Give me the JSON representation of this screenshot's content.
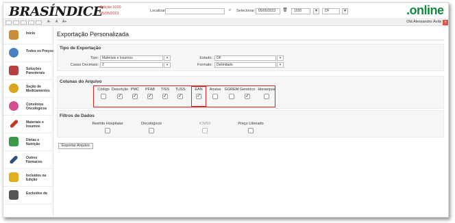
{
  "header": {
    "logo": "BRASÍNDICE",
    "edition": "Edição 1020",
    "date": "05/05/2023",
    "search_label": "Localizar:",
    "search_value": "",
    "search_btn": "⌕",
    "select_label": "Selecionar:",
    "select_date": "05/05/2023",
    "edition_num": "1020",
    "state": "DF",
    "brand": ".online"
  },
  "toolbar": {
    "font_small": "A-",
    "font_normal": "A",
    "font_large": "A+",
    "user": "Olá Alessandro Ávila",
    "close": "×"
  },
  "sidebar": {
    "items": [
      {
        "label": "Início",
        "icon": "home-icon",
        "color": "#c98d3b"
      },
      {
        "label": "Todos os Preços",
        "icon": "magnifier-icon",
        "color": "#4a7fc1"
      },
      {
        "label": "Soluções Parenterais",
        "icon": "iv-bag-icon",
        "color": "#b94040"
      },
      {
        "label": "Seção de Medicamentos",
        "icon": "pill-icon",
        "color": "#d9a420"
      },
      {
        "label": "Convênios Oncológicos",
        "icon": "ribbon-icon",
        "color": "#d14f8f"
      },
      {
        "label": "Materiais e Insumos",
        "icon": "pencil-icon",
        "color": "#c0392b"
      },
      {
        "label": "Dietas e Nutrição",
        "icon": "bottle-icon",
        "color": "#3a9a4a"
      },
      {
        "label": "Outros Fármacos",
        "icon": "syringe-icon",
        "color": "#2d4f7c"
      },
      {
        "label": "Incluídos na Edição",
        "icon": "box-plus-icon",
        "color": "#e0b020"
      },
      {
        "label": "Excluídos da",
        "icon": "box-minus-icon",
        "color": "#555"
      }
    ]
  },
  "main": {
    "title": "Exportação Personalizada",
    "tipo": {
      "title": "Tipo de Exportação",
      "tipo_label": "Tipo:",
      "tipo_value": "Materiais e Insumos",
      "casas_label": "Casas Decimais:",
      "casas_value": "2",
      "estado_label": "Estado:",
      "estado_value": "DF",
      "formato_label": "Formato:",
      "formato_value": "Delimitado"
    },
    "colunas": {
      "title": "Colunas do Arquivo",
      "items": [
        {
          "label": "Código",
          "checked": false
        },
        {
          "label": "Descrição",
          "checked": true
        },
        {
          "label": "PMC",
          "checked": true
        },
        {
          "label": "PFAB",
          "checked": true
        },
        {
          "label": "TISS",
          "checked": true
        },
        {
          "label": "TUSS",
          "checked": true
        },
        {
          "label": "EAN",
          "checked": true
        },
        {
          "label": "Anvisa",
          "checked": false
        },
        {
          "label": "GGREM",
          "checked": false
        },
        {
          "label": "Genérico",
          "checked": true
        },
        {
          "label": "Hierarquia",
          "checked": false
        }
      ]
    },
    "filtros": {
      "title": "Filtros de Dados",
      "items": [
        {
          "label": "Restrito Hospitalar",
          "checked": false
        },
        {
          "label": "Oncológicos",
          "checked": false
        },
        {
          "label": "ICMS0",
          "checked": false
        },
        {
          "label": "Preço Liberado",
          "checked": false
        }
      ]
    },
    "export_button": "Exportar Arquivo"
  }
}
